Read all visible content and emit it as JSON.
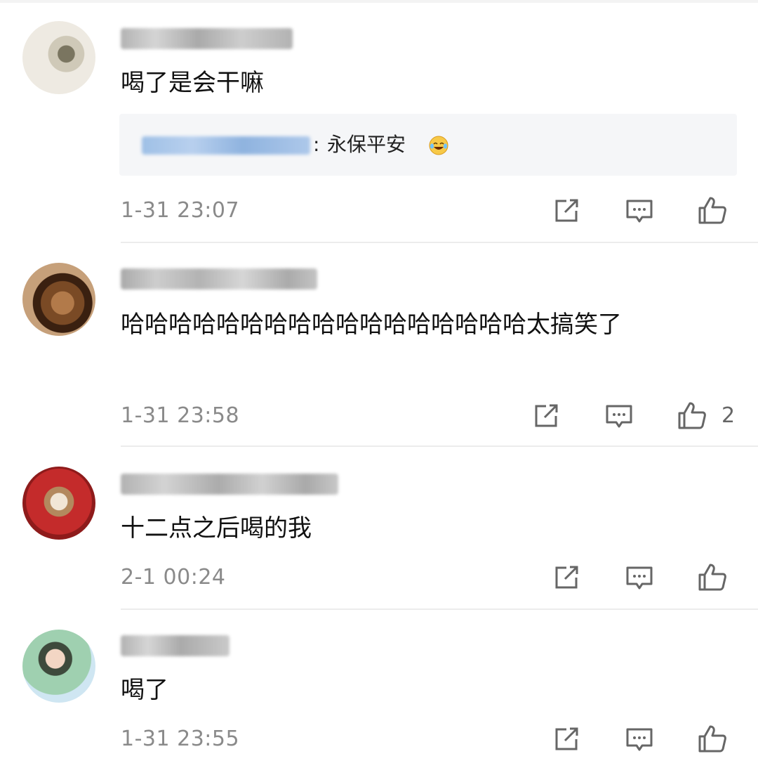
{
  "comments": [
    {
      "text": "喝了是会干嘛",
      "reply": {
        "text": "永保平安"
      },
      "time": "1-31 23:07",
      "like_count": ""
    },
    {
      "text": "哈哈哈哈哈哈哈哈哈哈哈哈哈哈哈哈哈太搞笑了",
      "time": "1-31 23:58",
      "like_count": "2"
    },
    {
      "text": "十二点之后喝的我",
      "time": "2-1 00:24",
      "like_count": ""
    },
    {
      "text": "喝了",
      "time": "1-31 23:55",
      "like_count": ""
    }
  ],
  "icons": {
    "share": "share-icon",
    "comment": "comment-icon",
    "like": "thumbs-up-icon",
    "reply_emoji": "laugh-cry-emoji"
  },
  "colors": {
    "text": "#111111",
    "meta": "#8a8a8a",
    "reply_bg": "#f5f6f8",
    "reply_name": "#9fc0e6",
    "icon": "#666666"
  }
}
